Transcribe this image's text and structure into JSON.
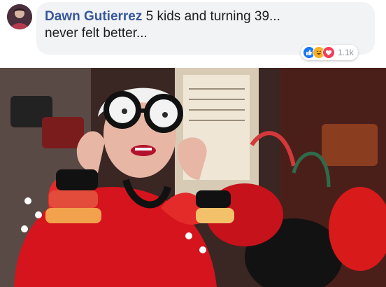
{
  "comment": {
    "author": "Dawn Gutierrez",
    "text_line1": "5 kids and turning 39...",
    "text_line2": "never felt better...",
    "avatar_icon": "user-avatar",
    "reactions": {
      "icons": [
        "like-icon",
        "haha-icon",
        "love-icon"
      ],
      "count": "1.1k",
      "colors": {
        "like": "#1877f2",
        "haha": "#f7b125",
        "love": "#f33e58"
      }
    }
  },
  "photo": {
    "icon": "elderly-woman-photo"
  }
}
